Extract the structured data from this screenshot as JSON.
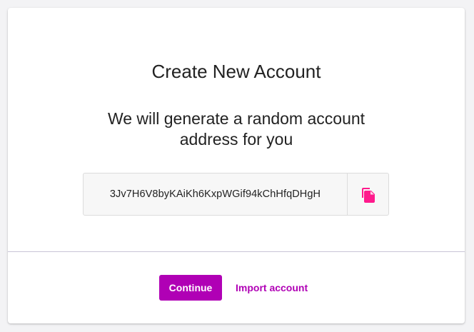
{
  "dialog": {
    "title": "Create New Account",
    "subtitle": "We will generate a random account address for you"
  },
  "address": {
    "value": "3Jv7H6V8byKAiKh6KxpWGif94kChHfqDHgH",
    "copy_icon": "copy-icon"
  },
  "actions": {
    "continue_label": "Continue",
    "import_label": "Import account"
  },
  "colors": {
    "accent": "#b000b5",
    "copy_icon": "#ff1a8c"
  }
}
